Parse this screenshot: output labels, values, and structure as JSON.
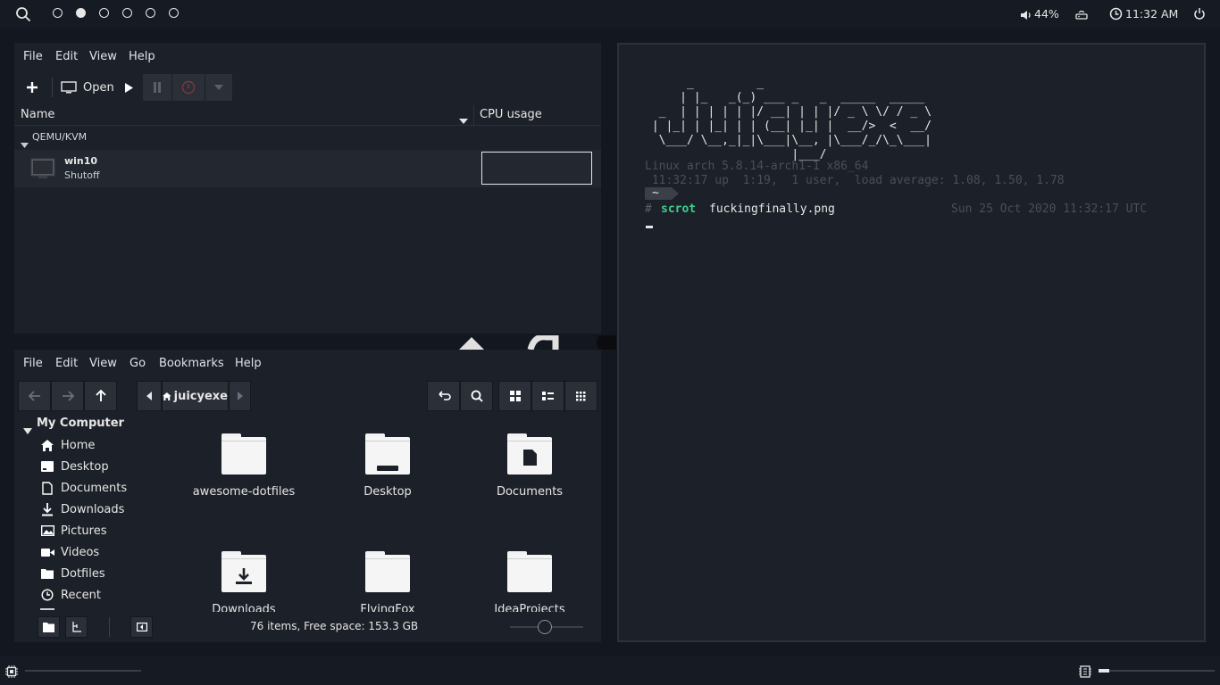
{
  "topbar": {
    "workspaces": [
      {
        "active": false
      },
      {
        "active": true
      },
      {
        "active": false
      },
      {
        "active": false
      },
      {
        "active": false
      },
      {
        "active": false
      }
    ],
    "volume": "44%",
    "clock": "11:32 AM"
  },
  "virt_manager": {
    "menu": [
      "File",
      "Edit",
      "View",
      "Help"
    ],
    "toolbar": {
      "open_label": "Open"
    },
    "columns": {
      "name": "Name",
      "cpu": "CPU usage"
    },
    "group": "QEMU/KVM",
    "vm": {
      "name": "win10",
      "state": "Shutoff"
    }
  },
  "file_manager": {
    "menu": [
      "File",
      "Edit",
      "View",
      "Go",
      "Bookmarks",
      "Help"
    ],
    "breadcrumb": "juicyexe",
    "sidebar": {
      "header": "My Computer",
      "items": [
        {
          "label": "Home",
          "icon": "home-icon"
        },
        {
          "label": "Desktop",
          "icon": "desktop-icon"
        },
        {
          "label": "Documents",
          "icon": "document-icon"
        },
        {
          "label": "Downloads",
          "icon": "download-icon"
        },
        {
          "label": "Pictures",
          "icon": "picture-icon"
        },
        {
          "label": "Videos",
          "icon": "video-icon"
        },
        {
          "label": "Dotfiles",
          "icon": "folder-icon"
        },
        {
          "label": "Recent",
          "icon": "clock-icon"
        }
      ]
    },
    "items": [
      "awesome-dotfiles",
      "Desktop",
      "Documents",
      "Downloads",
      "FlyingFox",
      "IdeaProjects"
    ],
    "status": "76 items, Free space: 153.3 GB"
  },
  "terminal": {
    "ascii_art": "      _         _\n     | |_   _(_) ___ _   _  _____  _____\n  _  | | | | | |/ __| | | |/ _ \\ \\/ / _ \\\n | |_| | |_| | | (__| |_| |  __/>  <  __/\n  \\___/ \\__,_|_|\\___|\\__, |\\___/_/\\_\\___|\n                     |___/",
    "kernel": "Linux arch 5.8.14-arch1-1 x86_64",
    "uptime": " 11:32:17 up  1:19,  1 user,  load average: 1.08, 1.50, 1.78",
    "dir": "~",
    "prompt": "#",
    "command": "scrot",
    "args": "fuckingfinally.png",
    "timestamp": "Sun 25 Oct 2020 11:32:17 UTC"
  },
  "colors": {
    "accent": "#3ecf8e",
    "background": "#131720",
    "window": "#1c2028"
  }
}
